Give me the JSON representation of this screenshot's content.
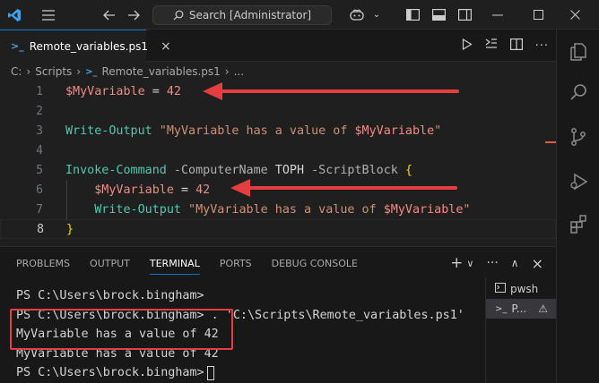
{
  "titlebar": {
    "search_label": "Search [Administrator]",
    "app_icon": "vscode-logo-icon",
    "menu_icon": "hamburger-menu-icon",
    "back_icon": "arrow-left-icon",
    "forward_icon": "arrow-right-icon",
    "copilot_icon": "copilot-icon",
    "window_controls": [
      "minimize",
      "maximize",
      "close"
    ]
  },
  "tab": {
    "filename": "Remote_variables.ps1",
    "close_glyph": "×"
  },
  "breadcrumb": {
    "drive": "C:",
    "folder": "Scripts",
    "file": "Remote_variables.ps1",
    "more": "..."
  },
  "editor": {
    "line_numbers": [
      "1",
      "2",
      "3",
      "4",
      "5",
      "6",
      "7",
      "8"
    ],
    "line1": {
      "var": "$MyVariable",
      "op": " = ",
      "num": "42"
    },
    "line3": {
      "cmd": "Write-Output",
      "str1": " \"MyVariable has a value of ",
      "strvar": "$MyVariable",
      "str2": "\""
    },
    "line5": {
      "cmd": "Invoke-Command",
      "p1": " -ComputerName",
      "v1": " TOPH",
      "p2": " -ScriptBlock",
      "brace": " {"
    },
    "line6": {
      "indent": "    ",
      "var": "$MyVariable",
      "op": " = ",
      "num": "42"
    },
    "line7": {
      "indent": "    ",
      "cmd": "Write-Output",
      "str1": " \"MyVariable has a value of ",
      "strvar": "$MyVariable",
      "str2": "\""
    },
    "line8": {
      "brace": "}"
    }
  },
  "panel": {
    "tabs": [
      "PROBLEMS",
      "OUTPUT",
      "TERMINAL",
      "PORTS",
      "DEBUG CONSOLE"
    ],
    "active_tab": "TERMINAL",
    "actions": {
      "new": "+",
      "dropdown": "∨",
      "more": "···",
      "maximize": "∧",
      "close": "×"
    }
  },
  "terminal": {
    "lines": [
      "PS C:\\Users\\brock.bingham>",
      "PS C:\\Users\\brock.bingham> . 'C:\\Scripts\\Remote_variables.ps1'",
      "MyVariable has a value of 42",
      "MyVariable has a value of 42",
      "PS C:\\Users\\brock.bingham>"
    ],
    "sessions": [
      {
        "label": "pwsh",
        "selected": false
      },
      {
        "label": "P...",
        "selected": true,
        "warning": "⚠"
      }
    ]
  },
  "colors": {
    "accent": "#0078d4",
    "annotation": "#e53e3e",
    "variable": "#f28b82",
    "command": "#4ec9b0",
    "string": "#ce9178"
  }
}
